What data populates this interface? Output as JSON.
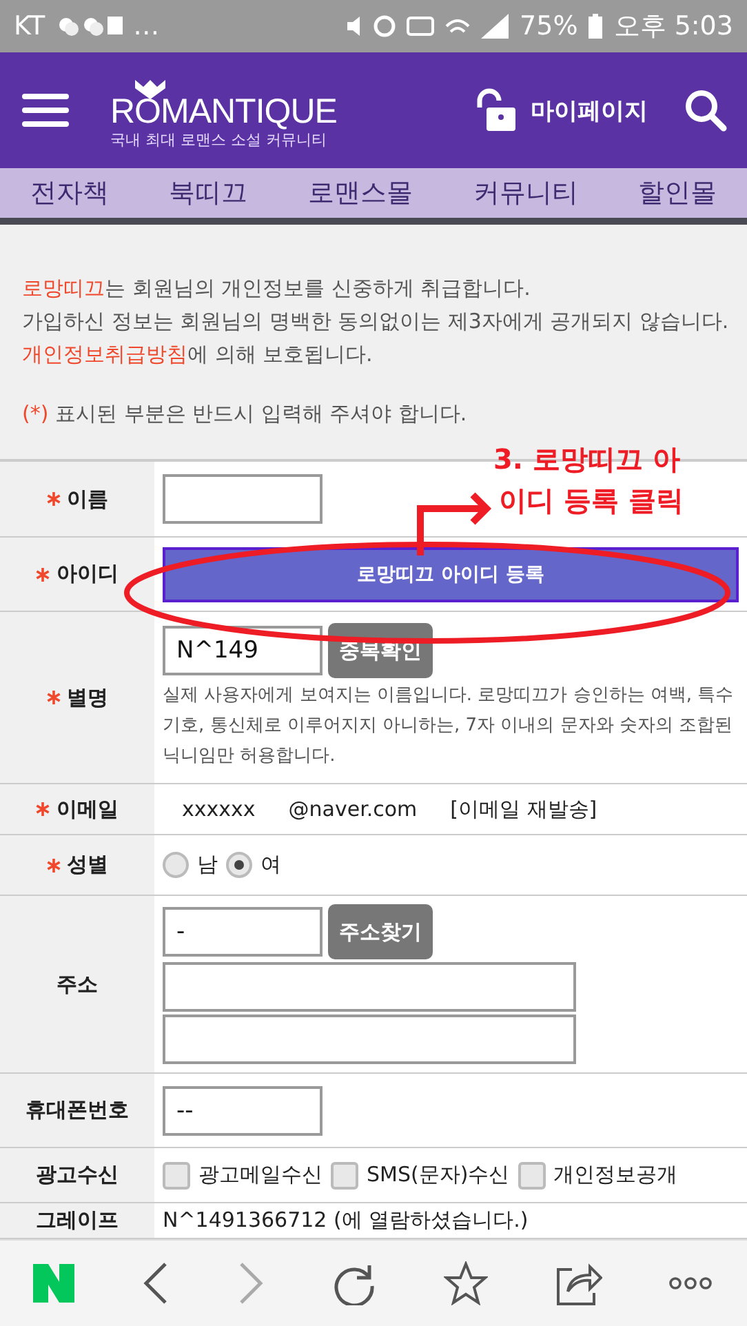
{
  "status_bar": {
    "carrier": "KT",
    "more": "…",
    "battery": "75%",
    "time": "오후 5:03"
  },
  "header": {
    "logo": "ROMANTIQUE",
    "tagline": "국내 최대 로맨스 소설 커뮤니티",
    "mypage": "마이페이지"
  },
  "tabs": [
    {
      "label": "전자책"
    },
    {
      "label": "북띠끄"
    },
    {
      "label": "로맨스몰"
    },
    {
      "label": "커뮤니티"
    },
    {
      "label": "할인몰"
    }
  ],
  "notice": {
    "paragraphs": [
      {
        "parts": [
          {
            "text": "로망띠끄",
            "highlight": true
          },
          {
            "text": "는 회원님의 개인정보를 신중하게 취급합니다.",
            "highlight": false
          }
        ]
      },
      {
        "parts": [
          {
            "text": "가입하신 정보는 회원님의 명백한 동의없이는 제3자에게 공개되지 않습니다.",
            "highlight": false
          }
        ]
      },
      {
        "parts": [
          {
            "text": "개인정보취급방침",
            "highlight": true
          },
          {
            "text": "에 의해 보호됩니다.",
            "highlight": false
          }
        ]
      }
    ],
    "required_mark": "(*)",
    "required_text": "표시된 부분은 반드시 입력해 주셔야 합니다."
  },
  "form": [
    {
      "kind": "text",
      "label": "이름",
      "required": true
    },
    {
      "kind": "button",
      "label": "아이디",
      "required": true,
      "button": "로망띠끄 아이디 등록"
    },
    {
      "kind": "nickname",
      "label": "별명",
      "required": true,
      "value": "N^149",
      "button": "중복확인",
      "help": "실제 사용자에게 보여지는 이름입니다. 로망띠끄가 승인하는 여백, 특수기호, 통신체로 이루어지지 아니하는, 7자 이내의 문자와 숫자의 조합된 닉니임만 허용합니다."
    },
    {
      "kind": "email",
      "label": "이메일",
      "required": true,
      "value": "xxxxxx",
      "domain": "@naver.com",
      "link": "[이메일 재발송]"
    },
    {
      "kind": "radio",
      "label": "성별",
      "required": true,
      "options": [
        {
          "label": "남",
          "selected": false
        },
        {
          "label": "여",
          "selected": true
        }
      ]
    },
    {
      "kind": "address",
      "label": "주소",
      "required": false,
      "value": "-",
      "button": "주소찾기"
    },
    {
      "kind": "text",
      "label": "휴대폰번호",
      "required": false,
      "value": "--"
    },
    {
      "kind": "checkboxes",
      "label": "광고수신",
      "required": false,
      "options": [
        {
          "label": "광고메일수신",
          "checked": false
        },
        {
          "label": "SMS(문자)수신",
          "checked": false
        },
        {
          "label": "개인정보공개",
          "checked": false
        }
      ]
    },
    {
      "kind": "plain",
      "label": "그레이프",
      "required": false,
      "value": "N^1491366712 (에 열람하셨습니다.)"
    }
  ],
  "annotation": {
    "lines": [
      "3. 로망띠끄 아",
      "이디 등록 클릭"
    ]
  }
}
